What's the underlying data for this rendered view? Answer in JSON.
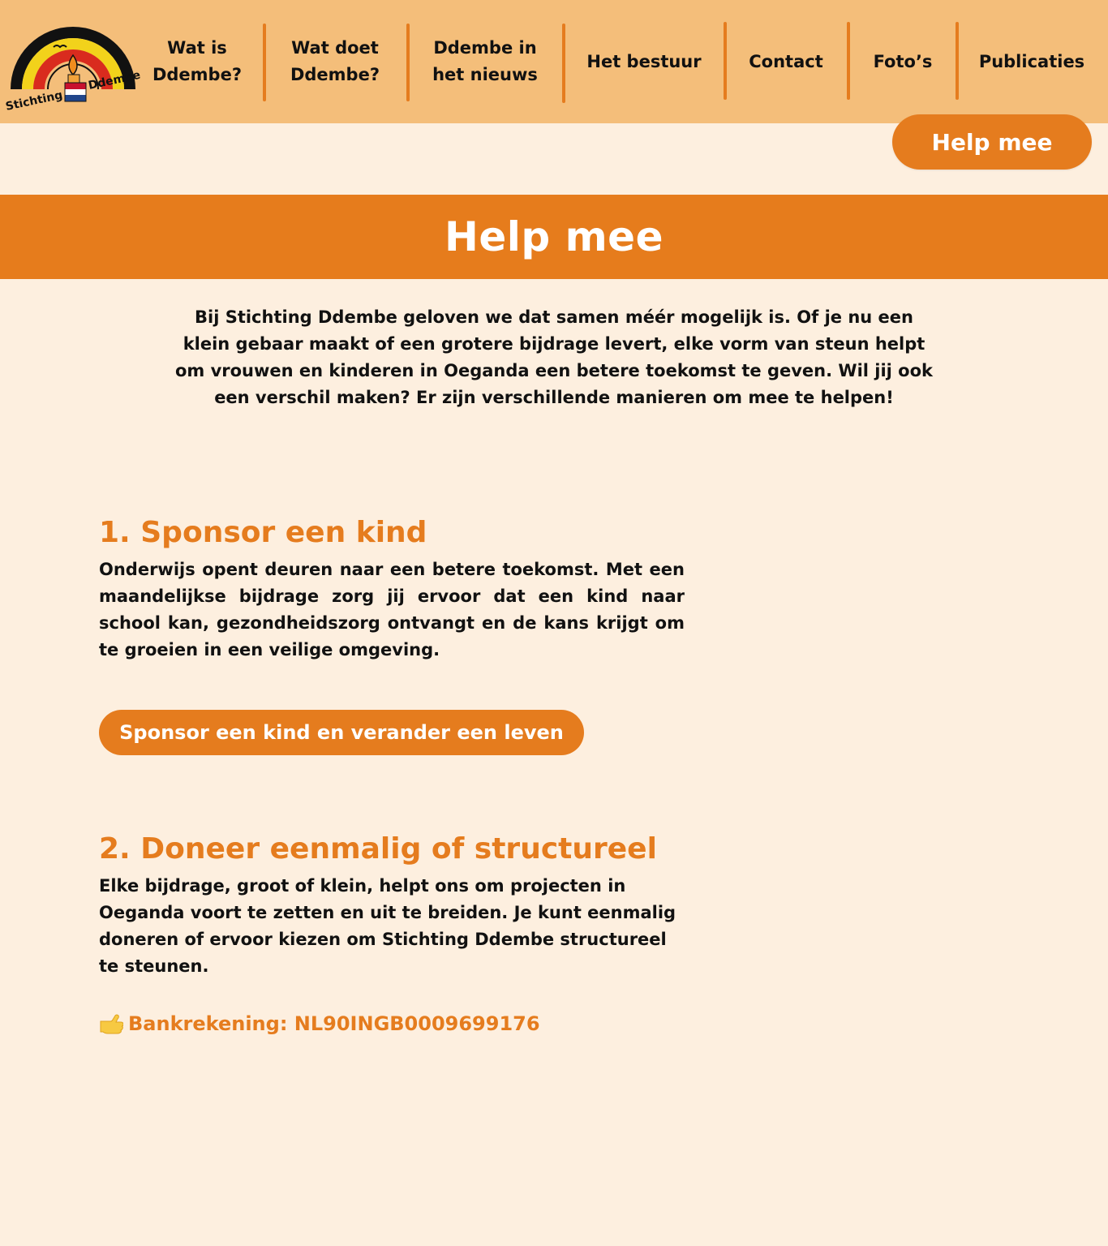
{
  "header": {
    "logo": {
      "text_top": "Ddembe",
      "text_bottom": "Stichting"
    },
    "nav": [
      {
        "label": "Wat is\nDdembe?"
      },
      {
        "label": "Wat doet\nDdembe?"
      },
      {
        "label": "Ddembe in\nhet nieuws"
      },
      {
        "label": "Het bestuur"
      },
      {
        "label": "Contact"
      },
      {
        "label": "Foto’s"
      },
      {
        "label": "Publicaties"
      }
    ],
    "cta_label": "Help mee"
  },
  "banner": {
    "title": "Help mee"
  },
  "intro": {
    "text": "Bij Stichting Ddembe geloven we dat samen méér mogelijk is. Of je nu een klein gebaar maakt of een grotere bijdrage levert, elke vorm van steun helpt om vrouwen en kinderen in Oeganda een betere toekomst te geven. Wil jij ook een verschil maken? Er zijn verschillende manieren om mee te helpen!"
  },
  "sections": [
    {
      "title": "1. Sponsor een kind",
      "text": "Onderwijs opent deuren naar een betere toekomst. Met een maandelijkse bijdrage zorg jij ervoor dat een kind naar school kan, gezondheidszorg ontvangt en de kans krijgt om te groeien in een veilige omgeving.",
      "button_label": "Sponsor een kind en verander een leven"
    },
    {
      "title": "2. Doneer eenmalig of structureel",
      "text": "Elke bijdrage, groot of klein, helpt ons om projecten in Oeganda voort te zetten en uit te breiden. Je kunt eenmalig doneren of ervoor kiezen om Stichting Ddembe structureel te steunen.",
      "bank_label": "Bankrekening: NL90INGB0009699176",
      "bank_icon": "pointing-hand-icon"
    }
  ],
  "colors": {
    "header_bg": "#F4BE7A",
    "page_bg": "#FDEFDF",
    "accent": "#E57C1E",
    "text": "#111111"
  }
}
